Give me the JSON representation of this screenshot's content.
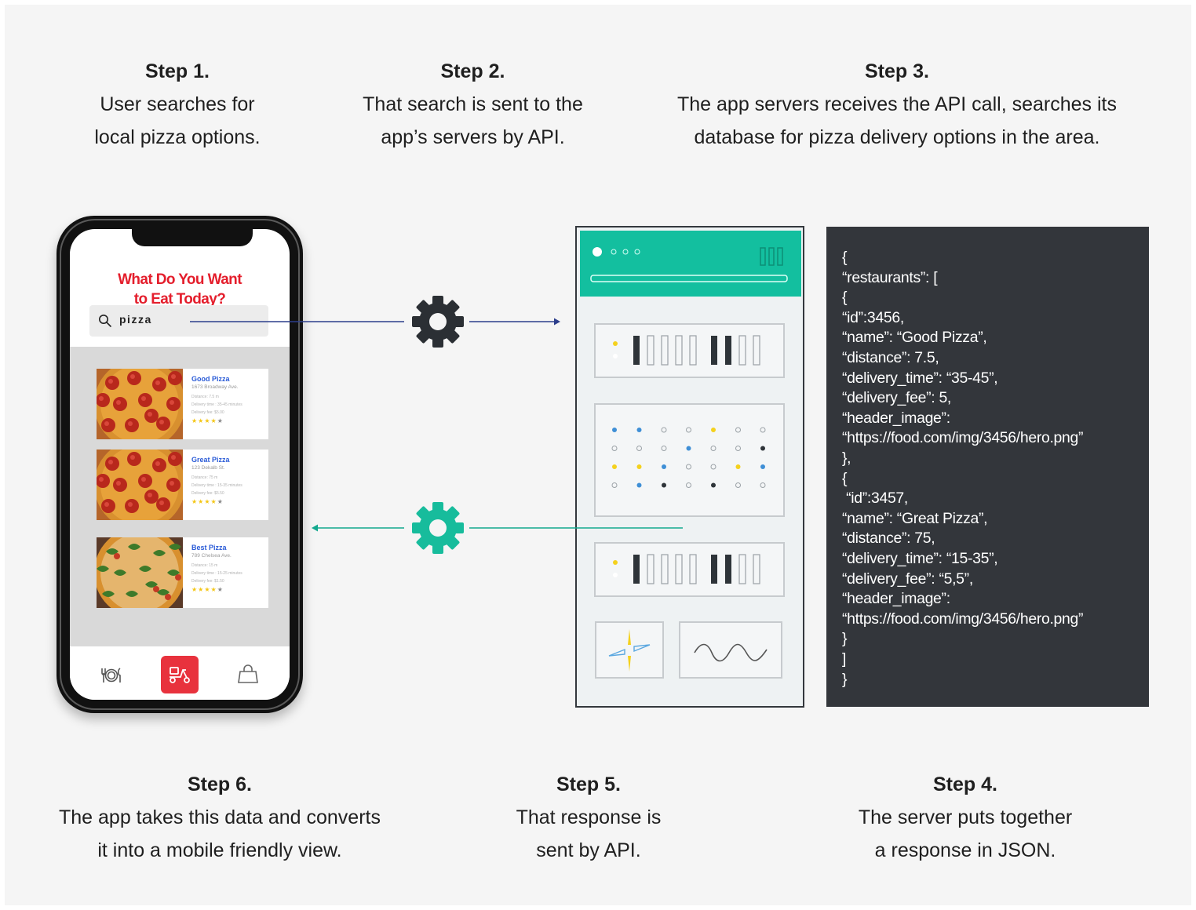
{
  "steps": {
    "s1": {
      "title": "Step 1.",
      "line1": "User searches for",
      "line2": "local pizza options."
    },
    "s2": {
      "title": "Step 2.",
      "line1": "That search is sent to the",
      "line2": "app’s servers by API."
    },
    "s3": {
      "title": "Step 3.",
      "line1": "The app servers receives the API call, searches its",
      "line2": "database for pizza delivery options in the area."
    },
    "s4": {
      "title": "Step 4.",
      "line1": "The server puts together",
      "line2": "a response in JSON."
    },
    "s5": {
      "title": "Step 5.",
      "line1": "That response is",
      "line2": "sent by API."
    },
    "s6": {
      "title": "Step 6.",
      "line1": "The app takes this data and converts",
      "line2": "it into a mobile friendly view."
    }
  },
  "phone": {
    "title_line1": "What Do You Want",
    "title_line2": "to Eat Today?",
    "search_value": "pizza",
    "restaurants": [
      {
        "name": "Good Pizza",
        "address": "1673 Broadway Ave.",
        "distance": "Distance: 7.5 m",
        "delivery_time": "Delivery time : 35-45 minutes",
        "delivery_fee": "Delivery fee: $5.00",
        "rating": 4
      },
      {
        "name": "Great Pizza",
        "address": "123 Dekalb St.",
        "distance": "Distance: 75 m",
        "delivery_time": "Delivery time : 15-35 minutes",
        "delivery_fee": "Delivery fee: $5.50",
        "rating": 4
      },
      {
        "name": "Best Pizza",
        "address": "789 Chelsea Ave.",
        "distance": "Distance: 15 m",
        "delivery_time": "Delivery time : 15-25 minutes",
        "delivery_fee": "Delivery fee: $1.50",
        "rating": 4
      }
    ],
    "tabs": [
      {
        "icon": "dining-icon",
        "active": false
      },
      {
        "icon": "delivery-scooter-icon",
        "active": true
      },
      {
        "icon": "shopping-bag-icon",
        "active": false
      }
    ]
  },
  "json_response": [
    "{",
    "“restaurants”: [",
    "{",
    "“id”:3456,",
    "“name”: “Good Pizza”,",
    "“distance”: 7.5,",
    "“delivery_time”: “35-45”,",
    "“delivery_fee”: 5,",
    "“header_image”:",
    "“https://food.com/img/3456/hero.png”",
    "},",
    "{",
    " “id”:3457,",
    "“name”: “Great Pizza”,",
    "“distance”: 75,",
    "“delivery_time”: “15-35”,",
    "“delivery_fee”: “5,5”,",
    "“header_image”:",
    "“https://food.com/img/3456/hero.png”",
    "}",
    "]",
    "}"
  ],
  "colors": {
    "request_arrow": "#2c3e8c",
    "response_arrow": "#13a98f",
    "request_gear": "#2b2f34",
    "response_gear": "#17bc9c",
    "accent_red": "#e41e2c",
    "server_teal": "#13bf9f",
    "code_bg": "#33363b"
  }
}
